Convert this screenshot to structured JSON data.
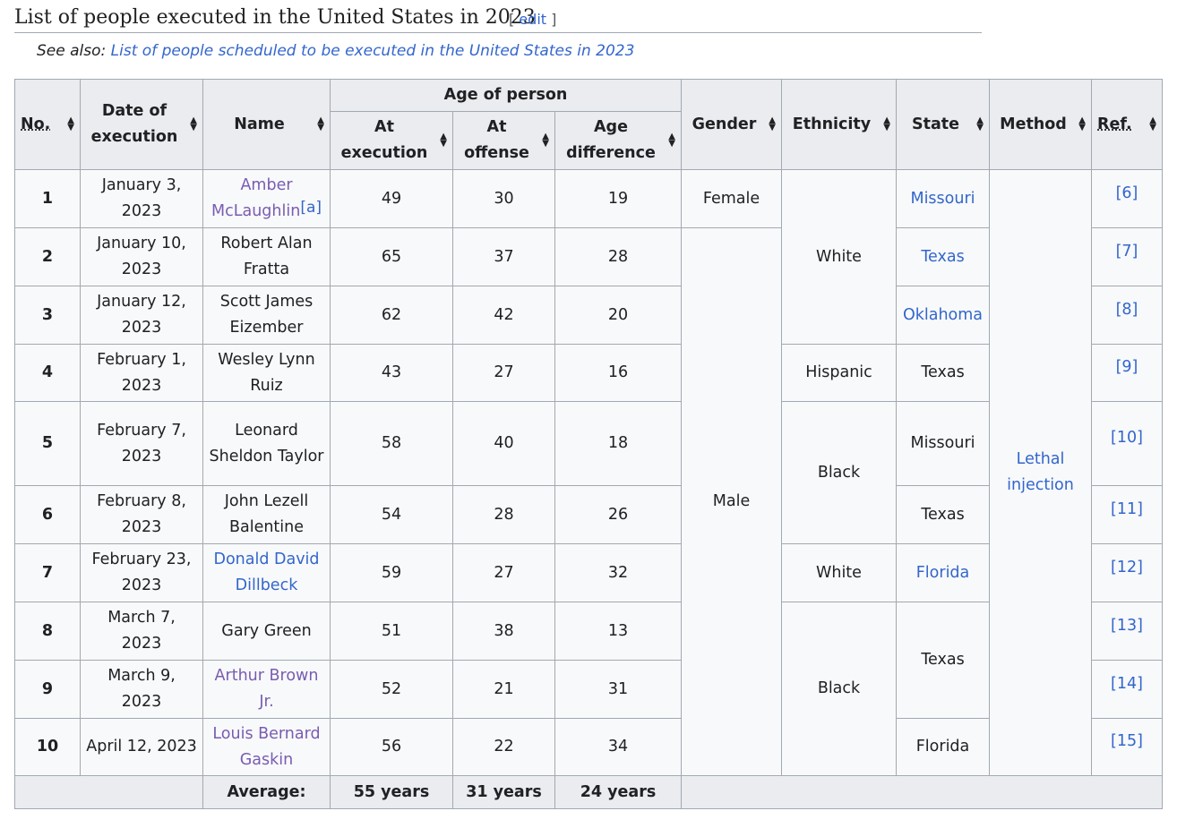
{
  "section": {
    "title": "List of people executed in the United States in 2023",
    "edit_open": "[ ",
    "edit_label": "edit",
    "edit_close": " ]"
  },
  "see_also": {
    "prefix": "See also: ",
    "link": "List of people scheduled to be executed in the United States in 2023"
  },
  "table": {
    "headers": {
      "no": "No.",
      "date": "Date of execution",
      "name": "Name",
      "age_group": "Age of person",
      "at_execution": "At execution",
      "at_offense": "At offense",
      "age_difference": "Age difference",
      "gender": "Gender",
      "ethnicity": "Ethnicity",
      "state": "State",
      "method": "Method",
      "ref": "Ref."
    },
    "rows": [
      {
        "no": "1",
        "date": "January 3, 2023",
        "name": "Amber McLaughlin",
        "note": "[a]",
        "exec": "49",
        "offense": "30",
        "diff": "19",
        "gender": "Female",
        "ethnicity": "White",
        "state": "Missouri",
        "method": "Lethal injection",
        "ref": "[6]"
      },
      {
        "no": "2",
        "date": "January 10, 2023",
        "name": "Robert Alan Fratta",
        "exec": "65",
        "offense": "37",
        "diff": "28",
        "gender": "Male",
        "state": "Texas",
        "ref": "[7]"
      },
      {
        "no": "3",
        "date": "January 12, 2023",
        "name": "Scott James Eizember",
        "exec": "62",
        "offense": "42",
        "diff": "20",
        "state": "Oklahoma",
        "ref": "[8]"
      },
      {
        "no": "4",
        "date": "February 1, 2023",
        "name": "Wesley Lynn Ruiz",
        "exec": "43",
        "offense": "27",
        "diff": "16",
        "ethnicity": "Hispanic",
        "state": "Texas",
        "ref": "[9]"
      },
      {
        "no": "5",
        "date": "February 7, 2023",
        "name": "Leonard Sheldon Taylor",
        "exec": "58",
        "offense": "40",
        "diff": "18",
        "ethnicity": "Black",
        "state": "Missouri",
        "ref": "[10]"
      },
      {
        "no": "6",
        "date": "February 8, 2023",
        "name": "John Lezell Balentine",
        "exec": "54",
        "offense": "28",
        "diff": "26",
        "state": "Texas",
        "ref": "[11]"
      },
      {
        "no": "7",
        "date": "February 23, 2023",
        "name": "Donald David Dillbeck",
        "exec": "59",
        "offense": "27",
        "diff": "32",
        "ethnicity": "White",
        "state": "Florida",
        "ref": "[12]"
      },
      {
        "no": "8",
        "date": "March 7, 2023",
        "name": "Gary Green",
        "exec": "51",
        "offense": "38",
        "diff": "13",
        "ethnicity": "Black",
        "state": "Texas",
        "ref": "[13]"
      },
      {
        "no": "9",
        "date": "March 9, 2023",
        "name": "Arthur Brown Jr.",
        "exec": "52",
        "offense": "21",
        "diff": "31",
        "ref": "[14]"
      },
      {
        "no": "10",
        "date": "April 12, 2023",
        "name": "Louis Bernard Gaskin",
        "exec": "56",
        "offense": "22",
        "diff": "34",
        "state": "Florida",
        "ref": "[15]"
      }
    ],
    "footer": {
      "label": "Average:",
      "exec": "55 years",
      "offense": "31 years",
      "diff": "24 years"
    }
  },
  "colors": {
    "link": "#3366cc",
    "visited_link": "#795cb2",
    "header_bg": "#eaecf0",
    "cell_bg": "#f8f9fa",
    "border": "#a2a9b1"
  },
  "icons": {
    "sort": "sort-arrows-icon"
  }
}
